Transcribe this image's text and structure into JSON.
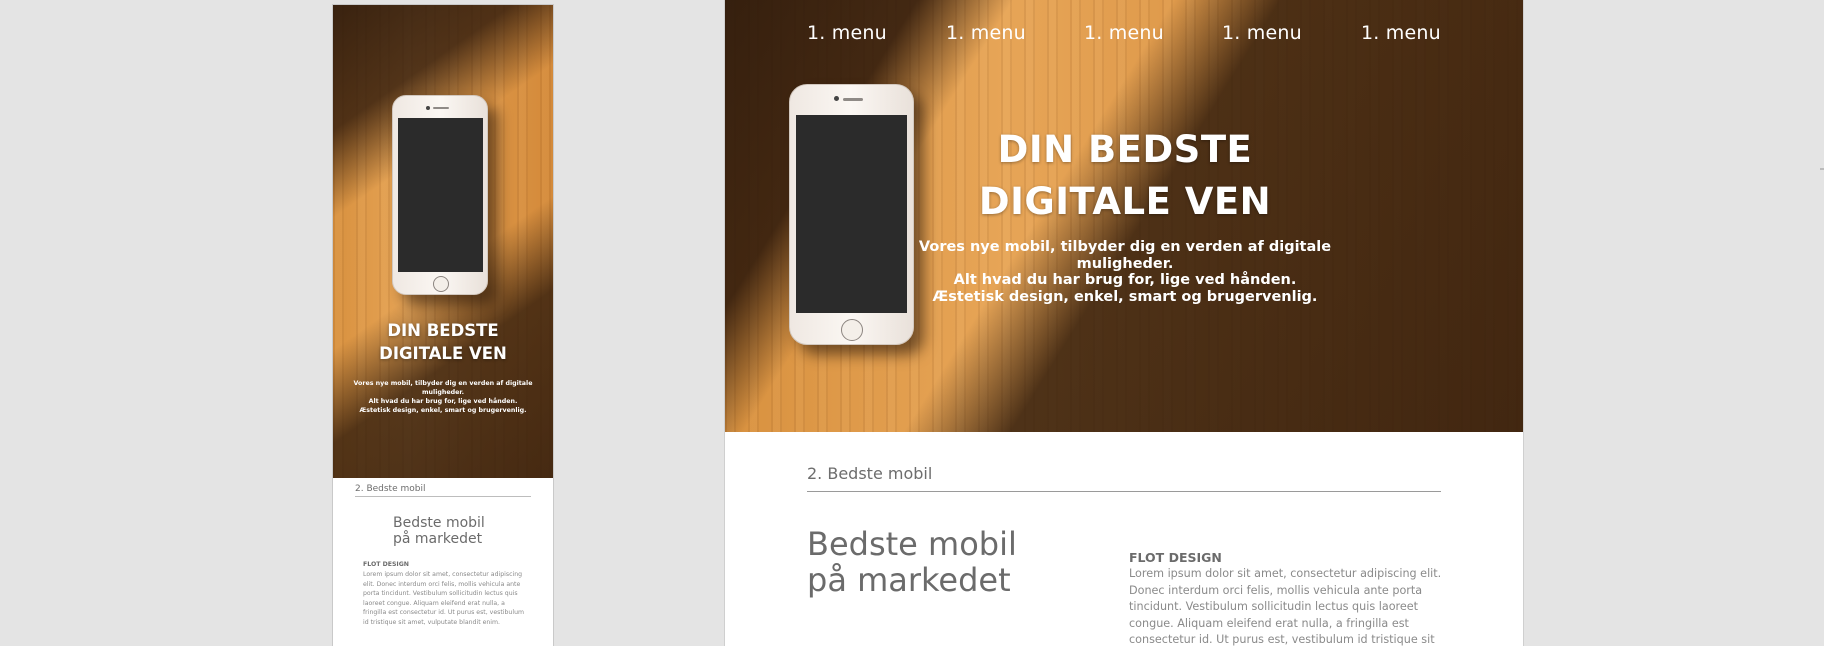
{
  "nav": {
    "items": [
      "1. menu",
      "1. menu",
      "1. menu",
      "1. menu",
      "1. menu"
    ]
  },
  "hero": {
    "title_line1": "DIN BEDSTE",
    "title_line2": "DIGITALE VEN",
    "sub_line1": "Vores nye mobil, tilbyder dig en verden af digitale muligheder.",
    "sub_line2": "Alt hvad du har brug for, lige ved hånden.",
    "sub_line3": "Æstetisk design, enkel, smart og brugervenlig."
  },
  "section": {
    "label": "2. Bedste mobil",
    "title_line1": "Bedste mobil",
    "title_line2": "på markedet",
    "feature_heading": "FLOT DESIGN",
    "feature_body": "Lorem ipsum dolor sit amet, consectetur adipiscing elit. Donec interdum orci felis, mollis vehicula ante porta tincidunt. Vestibulum sollicitudin lectus quis laoreet congue. Aliquam eleifend erat nulla, a fringilla est consectetur id. Ut purus est, vestibulum id tristique sit amet, vulputate blandit enim."
  },
  "colors": {
    "canvas": "#e4e4e4",
    "text_gray": "#6b6b6b",
    "wood": "#e7a557"
  }
}
